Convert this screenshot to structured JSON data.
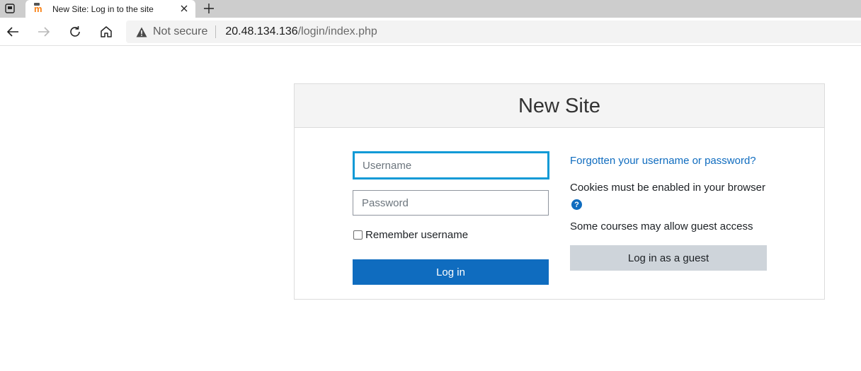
{
  "browser": {
    "tab": {
      "title": "New Site: Log in to the site",
      "favicon": "m"
    },
    "address": {
      "security_label": "Not secure",
      "host": "20.48.134.136",
      "path": "/login/index.php"
    },
    "icons": {
      "tab_actions": "tab-actions-icon",
      "close": "close-icon",
      "new_tab": "plus-icon",
      "back": "back-arrow-icon",
      "forward": "forward-arrow-icon",
      "refresh": "refresh-icon",
      "home": "home-icon",
      "warning": "warning-icon"
    }
  },
  "page": {
    "site_title": "New Site",
    "username_placeholder": "Username",
    "password_placeholder": "Password",
    "remember_label": "Remember username",
    "login_button": "Log in",
    "forgot_link": "Forgotten your username or password?",
    "cookies_text": "Cookies must be enabled in your browser",
    "help_symbol": "?",
    "guest_text": "Some courses may allow guest access",
    "guest_button": "Log in as a guest"
  },
  "colors": {
    "primary": "#0f6cbf",
    "focus_border": "#0f9ad6",
    "secondary_button": "#ced4da",
    "moodle_orange": "#f98012"
  }
}
